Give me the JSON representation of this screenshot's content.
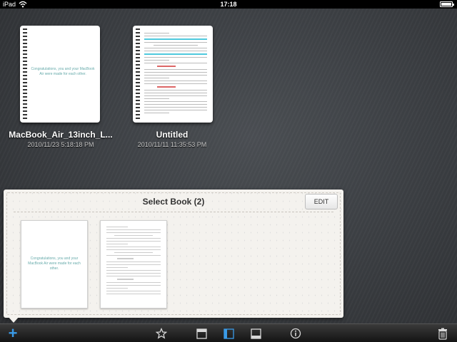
{
  "status_bar": {
    "carrier": "iPad",
    "time": "17:18",
    "battery_percent": 90
  },
  "shelf": {
    "books": [
      {
        "title": "MacBook_Air_13inch_L...",
        "date": "2010/11/23  5:18:18 PM",
        "cover_text": "Congratulations, you and your MacBook Air were made for each other."
      },
      {
        "title": "Untitled",
        "date": "2010/11/11  11:35:53 PM"
      }
    ]
  },
  "popup": {
    "title": "Select Book (2)",
    "edit_label": "EDIT",
    "thumbs": [
      {
        "cover_text": "Congratulations, you and your MacBook Air were made for each other."
      },
      {
        "cover_text": ""
      }
    ]
  },
  "toolbar": {
    "icons": [
      "add-icon",
      "star-icon",
      "layout-top-icon",
      "layout-side-icon",
      "layout-bottom-icon",
      "info-icon",
      "trash-icon"
    ],
    "add_label": "+",
    "active_layout": "layout-side-icon",
    "accent_color": "#3a9be8"
  }
}
